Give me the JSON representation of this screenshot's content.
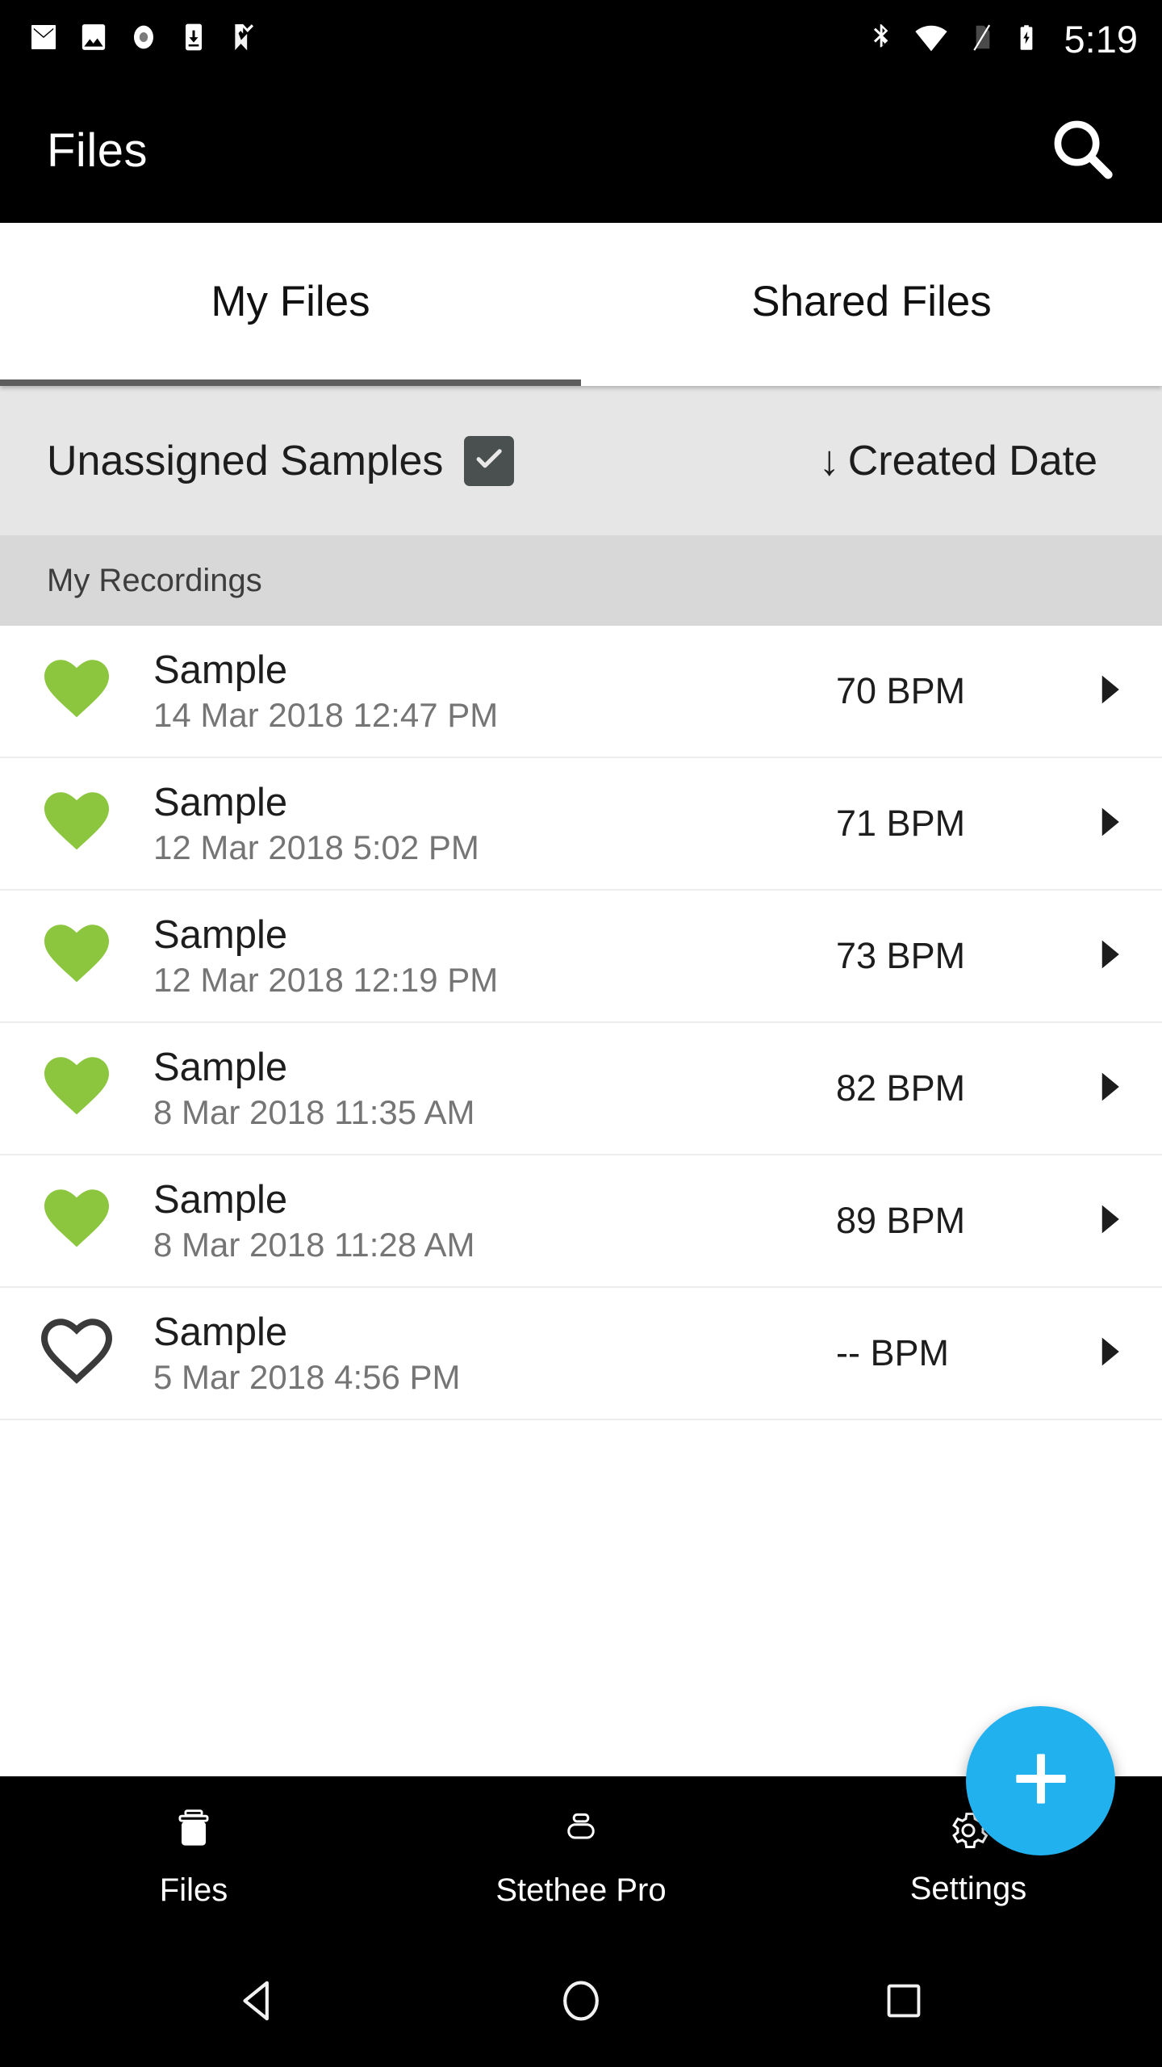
{
  "status_bar": {
    "time": "5:19",
    "left_icons": [
      "gmail-icon",
      "photos-icon",
      "record-icon",
      "download-to-device-icon",
      "checkmark-flag-icon"
    ],
    "right_icons": [
      "bluetooth-icon",
      "wifi-icon",
      "no-sim-icon",
      "battery-charging-icon"
    ]
  },
  "app_bar": {
    "title": "Files",
    "search_icon": "search-icon"
  },
  "tabs": {
    "items": [
      {
        "label": "My Files",
        "active": true
      },
      {
        "label": "Shared Files",
        "active": false
      }
    ]
  },
  "filter_bar": {
    "filter_label": "Unassigned Samples",
    "filter_checked": true,
    "sort_arrow": "↓",
    "sort_label": "Created Date"
  },
  "section": {
    "header": "My Recordings"
  },
  "recordings": [
    {
      "favorite": true,
      "title": "Sample",
      "date": "14 Mar 2018 12:47 PM",
      "bpm": "70 BPM"
    },
    {
      "favorite": true,
      "title": "Sample",
      "date": "12 Mar 2018 5:02 PM",
      "bpm": "71 BPM"
    },
    {
      "favorite": true,
      "title": "Sample",
      "date": "12 Mar 2018 12:19 PM",
      "bpm": "73 BPM"
    },
    {
      "favorite": true,
      "title": "Sample",
      "date": "8 Mar 2018 11:35 AM",
      "bpm": "82 BPM"
    },
    {
      "favorite": true,
      "title": "Sample",
      "date": "8 Mar 2018 11:28 AM",
      "bpm": "89 BPM"
    },
    {
      "favorite": false,
      "title": "Sample",
      "date": "5 Mar 2018 4:56 PM",
      "bpm": "-- BPM"
    }
  ],
  "fab": {
    "label": "+",
    "color": "#22b1ef"
  },
  "bottom_nav": {
    "items": [
      {
        "label": "Files",
        "icon": "briefcase-icon",
        "active": true
      },
      {
        "label": "Stethee Pro",
        "icon": "device-icon",
        "active": false
      },
      {
        "label": "Settings",
        "icon": "gear-icon",
        "active": false
      }
    ]
  },
  "system_nav": {
    "back": "back-triangle-icon",
    "home": "home-circle-icon",
    "recents": "recents-square-icon"
  },
  "colors": {
    "accent": "#22b1ef",
    "favorite_green": "#8cc63e",
    "filter_bg": "#e6e6e6",
    "section_bg": "#d8d8d8"
  }
}
